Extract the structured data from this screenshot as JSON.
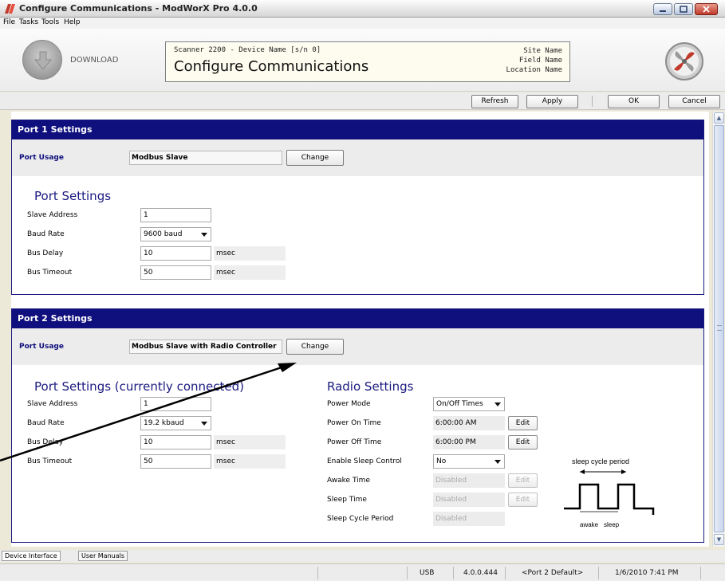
{
  "window": {
    "title": "Configure Communications - ModWorX Pro 4.0.0"
  },
  "menu": [
    "File",
    "Tasks",
    "Tools",
    "Help"
  ],
  "header": {
    "download_label": "DOWNLOAD",
    "device_line": "Scanner 2200 - Device Name [s/n 0]",
    "page_title": "Configure Communications",
    "site_name": "Site Name",
    "field_name": "Field Name",
    "location_name": "Location Name"
  },
  "toolbar": {
    "refresh": "Refresh",
    "apply": "Apply",
    "ok": "OK",
    "cancel": "Cancel"
  },
  "port1": {
    "header": "Port 1 Settings",
    "usage_label": "Port Usage",
    "usage_value": "Modbus Slave",
    "change": "Change",
    "section_title": "Port Settings",
    "slave_address_label": "Slave Address",
    "slave_address": "1",
    "baud_rate_label": "Baud Rate",
    "baud_rate": "9600 baud",
    "bus_delay_label": "Bus Delay",
    "bus_delay": "10",
    "bus_delay_unit": "msec",
    "bus_timeout_label": "Bus Timeout",
    "bus_timeout": "50",
    "bus_timeout_unit": "msec"
  },
  "port2": {
    "header": "Port 2 Settings",
    "usage_label": "Port Usage",
    "usage_value": "Modbus Slave with Radio Controller",
    "change": "Change",
    "section_title": "Port Settings (currently connected)",
    "slave_address_label": "Slave Address",
    "slave_address": "1",
    "baud_rate_label": "Baud Rate",
    "baud_rate": "19.2 kbaud",
    "bus_delay_label": "Bus Delay",
    "bus_delay": "10",
    "bus_delay_unit": "msec",
    "bus_timeout_label": "Bus Timeout",
    "bus_timeout": "50",
    "bus_timeout_unit": "msec"
  },
  "radio": {
    "section_title": "Radio Settings",
    "power_mode_label": "Power Mode",
    "power_mode": "On/Off Times",
    "power_on_label": "Power On Time",
    "power_on": "6:00:00 AM",
    "power_off_label": "Power Off Time",
    "power_off": "6:00:00 PM",
    "sleep_control_label": "Enable Sleep Control",
    "sleep_control": "No",
    "awake_time_label": "Awake Time",
    "awake_time": "Disabled",
    "sleep_time_label": "Sleep Time",
    "sleep_time": "Disabled",
    "sleep_cycle_label": "Sleep Cycle Period",
    "sleep_cycle": "Disabled",
    "edit": "Edit",
    "diagram_period": "sleep cycle period",
    "diagram_awake": "awake",
    "diagram_sleep": "sleep"
  },
  "bottom_tabs": [
    "Device Interface",
    "User Manuals"
  ],
  "status": {
    "connection": "USB",
    "version": "4.0.0.444",
    "port": "<Port 2 Default>",
    "datetime": "1/6/2010 7:41 PM"
  },
  "colors": {
    "panel_header": "#0f0f7d",
    "section_title": "#1a1a80"
  }
}
